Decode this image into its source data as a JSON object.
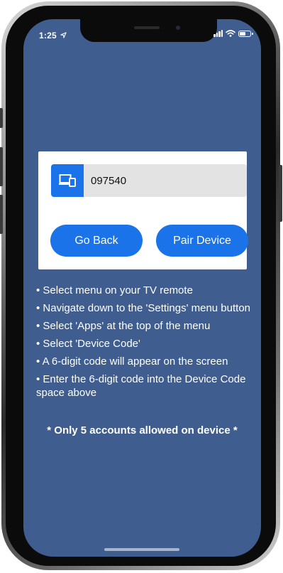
{
  "status_bar": {
    "time": "1:25",
    "location_icon": "location-arrow-icon",
    "signal_icon": "cellular-signal-icon",
    "wifi_icon": "wifi-icon",
    "battery_icon": "battery-icon"
  },
  "pairing_card": {
    "device_icon": "devices-icon",
    "code_value": "097540",
    "go_back_label": "Go Back",
    "pair_device_label": "Pair Device"
  },
  "instructions": [
    "• Select menu on your TV remote",
    "• Navigate down to the 'Settings' menu button",
    "• Select 'Apps' at the top of the menu",
    "• Select 'Device Code'",
    "• A 6-digit code will appear on the screen",
    "• Enter the 6-digit code into the Device Code space above"
  ],
  "warning": "* Only 5 accounts allowed on device *",
  "colors": {
    "screen_background": "#3f5e8f",
    "accent": "#1a73e8",
    "card_background": "#ffffff",
    "input_background": "#e3e3e3"
  }
}
